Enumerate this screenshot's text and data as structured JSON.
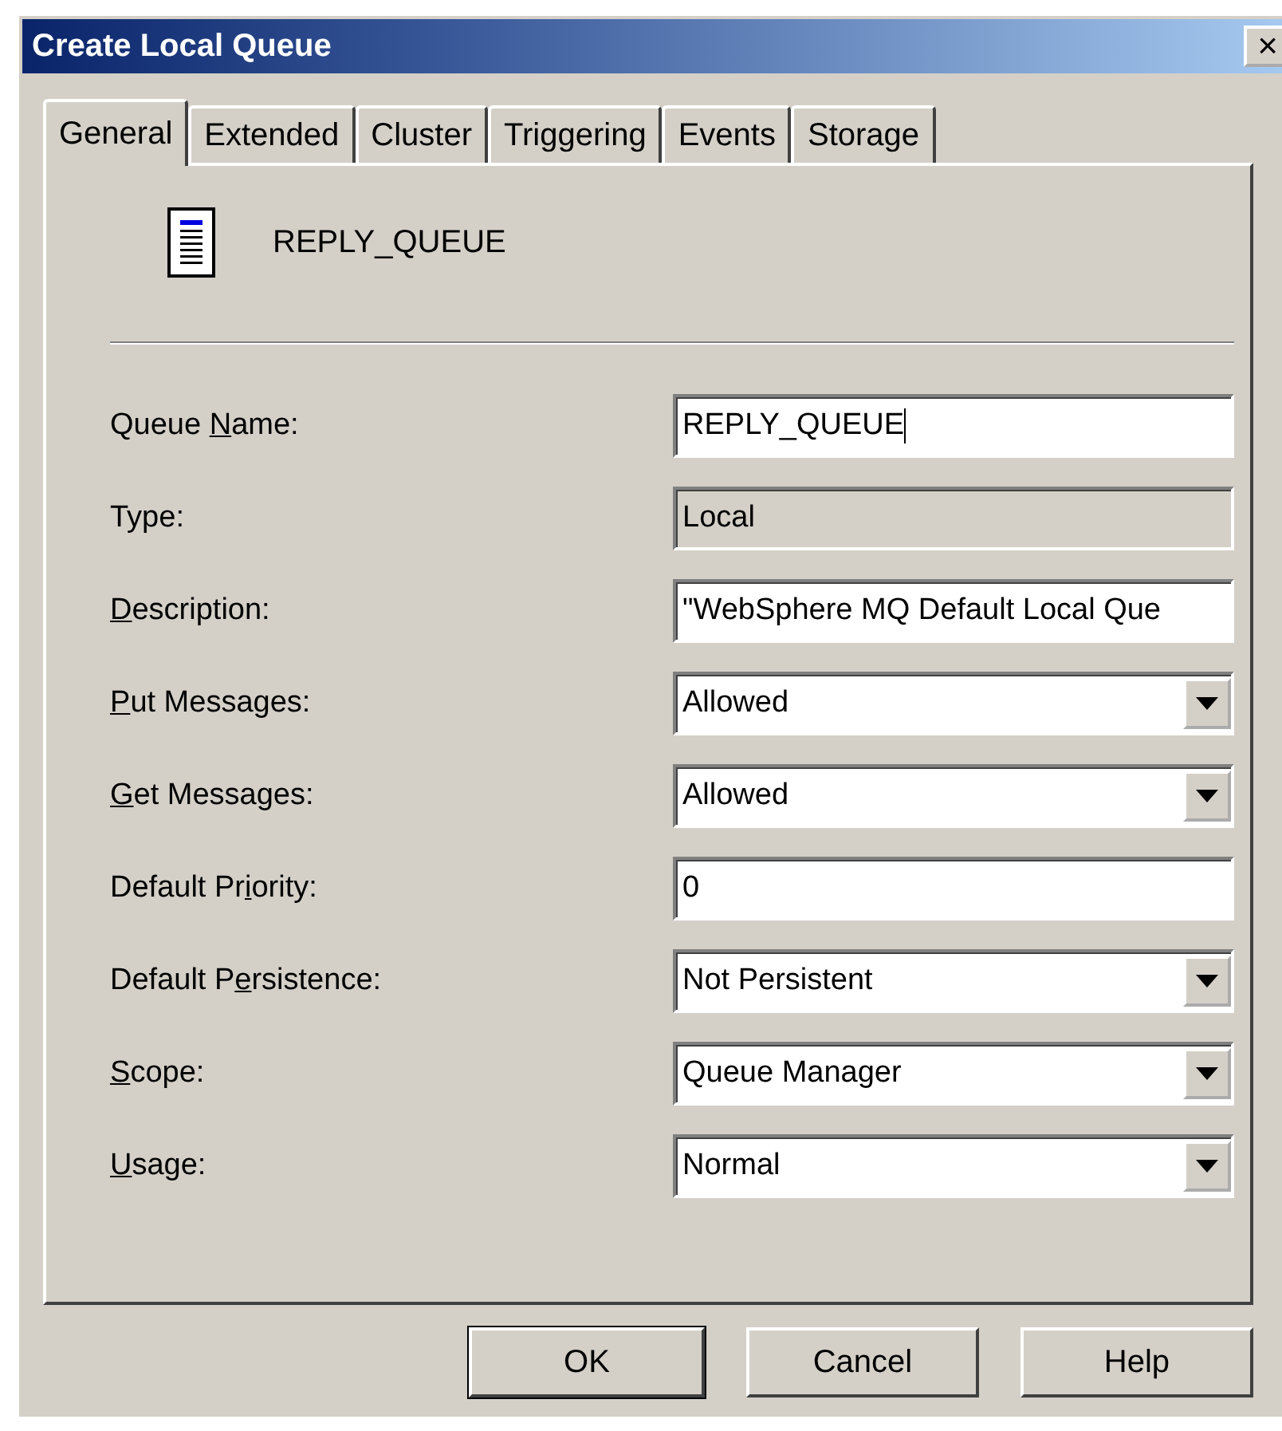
{
  "window": {
    "title": "Create Local Queue",
    "close": "×"
  },
  "tabs": [
    {
      "label": "General",
      "selected": true
    },
    {
      "label": "Extended",
      "selected": false
    },
    {
      "label": "Cluster",
      "selected": false
    },
    {
      "label": "Triggering",
      "selected": false
    },
    {
      "label": "Events",
      "selected": false
    },
    {
      "label": "Storage",
      "selected": false
    }
  ],
  "header": {
    "name": "REPLY_QUEUE"
  },
  "fields": [
    {
      "kind": "text",
      "label_start": "Queue ",
      "access_key": "N",
      "label_end": "ame:",
      "value": "REPLY_QUEUE",
      "focused": true,
      "disabled": false
    },
    {
      "kind": "text",
      "label_start": "Type:",
      "value": "Local",
      "focused": false,
      "disabled": true
    },
    {
      "kind": "text",
      "access_key": "D",
      "label_end": "escription:",
      "value": "\"WebSphere MQ Default Local Que",
      "focused": false,
      "disabled": false
    },
    {
      "kind": "select",
      "access_key": "P",
      "label_end": "ut Messages:",
      "value": "Allowed"
    },
    {
      "kind": "select",
      "access_key": "G",
      "label_end": "et Messages:",
      "value": "Allowed"
    },
    {
      "kind": "text",
      "label_start": "Default Pr",
      "access_key": "i",
      "label_end": "ority:",
      "value": "0",
      "focused": false,
      "disabled": false
    },
    {
      "kind": "select",
      "label_start": "Default P",
      "access_key": "e",
      "label_end": "rsistence:",
      "value": "Not Persistent"
    },
    {
      "kind": "select",
      "access_key": "S",
      "label_end": "cope:",
      "value": "Queue Manager"
    },
    {
      "kind": "select",
      "access_key": "U",
      "label_end": "sage:",
      "value": "Normal"
    }
  ],
  "buttons": [
    {
      "label": "OK",
      "default": true
    },
    {
      "label": "Cancel",
      "default": false
    },
    {
      "label": "Help",
      "default": false
    }
  ]
}
